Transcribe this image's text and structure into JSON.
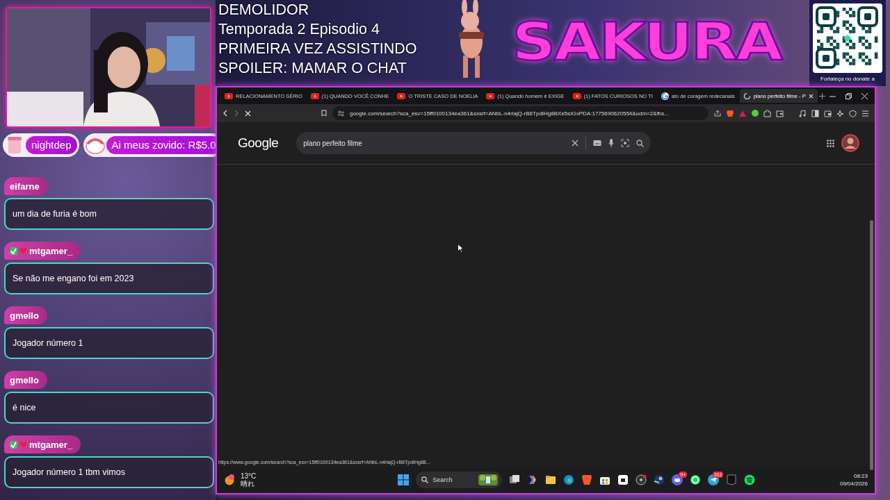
{
  "stream_title": {
    "lines": [
      "DEMOLIDOR",
      "Temporada 2 Episodio 4",
      "PRIMEIRA VEZ ASSISTINDO",
      "SPOILER: MAMAR O CHAT"
    ]
  },
  "logo": "SAKURA",
  "qr_caption": "Fortaleça no donate a",
  "donations": [
    {
      "text": "nightdep"
    },
    {
      "text": "Ai meus zovido: R$5.0"
    }
  ],
  "chat": [
    {
      "user": "eifarne",
      "badge": false,
      "message": "um dia de furia é bom"
    },
    {
      "user": "mtgamer_",
      "badge": true,
      "message": "Se não me engano foi em 2023"
    },
    {
      "user": "gmello",
      "badge": false,
      "message": "Jogador número 1"
    },
    {
      "user": "gmello",
      "badge": false,
      "message": "é nice"
    },
    {
      "user": "mtgamer_",
      "badge": true,
      "message": "Jogador número 1 tbm vimos"
    }
  ],
  "browser": {
    "tabs": [
      {
        "title": "RELACIONAMENTO SÉRIO",
        "kind": "youtube",
        "selected": false
      },
      {
        "title": "(1) QUANDO VOCÊ CONHE",
        "kind": "youtube",
        "selected": false
      },
      {
        "title": "O TRISTE CASO DE NOELIA",
        "kind": "youtube",
        "selected": false
      },
      {
        "title": "(1) Quando homem é EXIGE",
        "kind": "youtube",
        "selected": false
      },
      {
        "title": "(1) FATOS CURIOSOS NO TI",
        "kind": "youtube",
        "selected": false
      },
      {
        "title": "ato de coragem redecanais",
        "kind": "google",
        "selected": false
      },
      {
        "title": "plano perfeito filme - P",
        "kind": "loading",
        "selected": true
      }
    ],
    "address": "google.com/search?sca_esv=15ff0100134ea361&sxsrf=ANbL-n4riajQ-rB6TpdIHg8BXe5sIGxPDA:1775690620554&udm=2&fbs...",
    "page": {
      "logo": "Google",
      "query": "plano perfeito filme"
    },
    "status_url": "https://www.google.com/search?sca_esv=15ff0100134ea361&sxsrf=ANbL-n4riajQ-rB6TpdIHg88..."
  },
  "taskbar": {
    "temperature": "13°C",
    "condition": "晴れ",
    "search_placeholder": "Search",
    "discord_badge": "9+",
    "telegram_badge": "262",
    "time": "08:23",
    "date": "09/04/2026"
  }
}
